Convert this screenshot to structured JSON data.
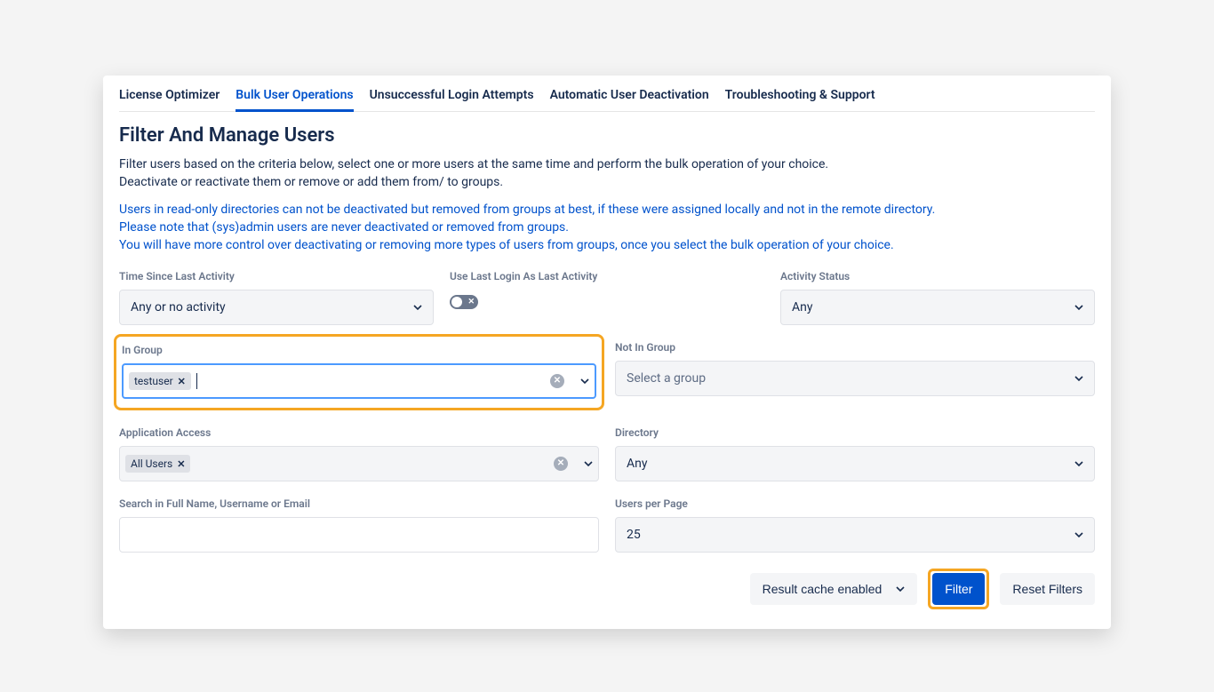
{
  "tabs": [
    {
      "label": "License Optimizer",
      "active": false
    },
    {
      "label": "Bulk User Operations",
      "active": true
    },
    {
      "label": "Unsuccessful Login Attempts",
      "active": false
    },
    {
      "label": "Automatic User Deactivation",
      "active": false
    },
    {
      "label": "Troubleshooting & Support",
      "active": false
    }
  ],
  "title": "Filter And Manage Users",
  "description_line1": "Filter users based on the criteria below, select one or more users at the same time and perform the bulk operation of your choice.",
  "description_line2": "Deactivate or reactivate them or remove or add them from/ to groups.",
  "note_line1": "Users in read-only directories can not be deactivated but removed from groups at best, if these were assigned locally and not in the remote directory.",
  "note_line2": "Please note that (sys)admin users are never deactivated or removed from groups.",
  "note_line3": "You will have more control over deactivating or removing more types of users from groups, once you select the bulk operation of your choice.",
  "fields": {
    "time_since_last_activity": {
      "label": "Time Since Last Activity",
      "value": "Any or no activity"
    },
    "use_last_login": {
      "label": "Use Last Login As Last Activity",
      "value": false
    },
    "activity_status": {
      "label": "Activity Status",
      "value": "Any"
    },
    "in_group": {
      "label": "In Group",
      "chips": [
        "testuser"
      ]
    },
    "not_in_group": {
      "label": "Not In Group",
      "placeholder": "Select a group"
    },
    "application_access": {
      "label": "Application Access",
      "chips": [
        "All Users"
      ]
    },
    "directory": {
      "label": "Directory",
      "value": "Any"
    },
    "search": {
      "label": "Search in Full Name, Username or Email",
      "value": ""
    },
    "users_per_page": {
      "label": "Users per Page",
      "value": "25"
    }
  },
  "actions": {
    "cache": "Result cache enabled",
    "filter": "Filter",
    "reset": "Reset Filters"
  }
}
